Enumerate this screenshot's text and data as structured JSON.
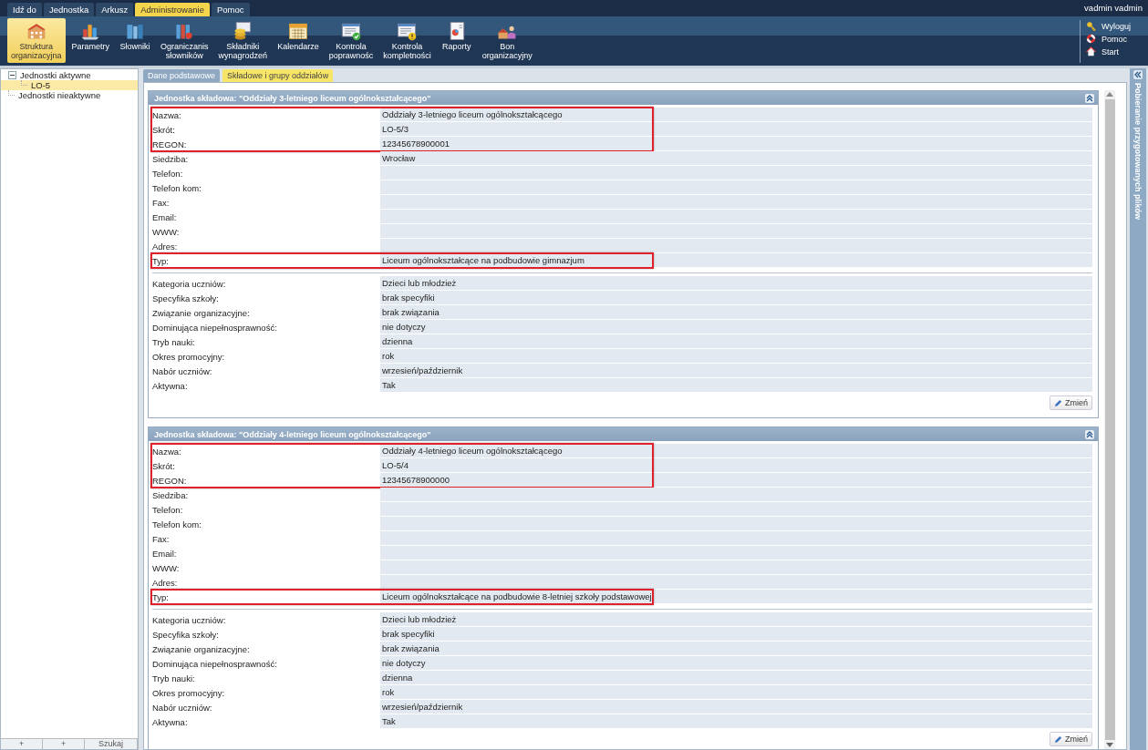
{
  "menu_bar": {
    "items": [
      {
        "label": "Idź do",
        "selected": false
      },
      {
        "label": "Jednostka",
        "selected": false
      },
      {
        "label": "Arkusz",
        "selected": false
      },
      {
        "label": "Administrowanie",
        "selected": true
      },
      {
        "label": "Pomoc",
        "selected": false
      }
    ],
    "user": "vadmin vadmin"
  },
  "toolbar": {
    "buttons": [
      {
        "label": "Struktura\norganizacyjna",
        "selected": true
      },
      {
        "label": "Parametry",
        "selected": false
      },
      {
        "label": "Słowniki",
        "selected": false
      },
      {
        "label": "Ograniczanis\nsłowników",
        "selected": false
      },
      {
        "label": "Składniki\nwynagrodzeń",
        "selected": false
      },
      {
        "label": "Kalendarze",
        "selected": false
      },
      {
        "label": "Kontrola\npoprawnośc",
        "selected": false
      },
      {
        "label": "Kontrola\nkompletności",
        "selected": false
      },
      {
        "label": "Raporty",
        "selected": false
      },
      {
        "label": "Bon\norganizacyjny",
        "selected": false
      }
    ],
    "links": [
      "Wyloguj",
      "Pomoc",
      "Start"
    ]
  },
  "sidebar": {
    "tree": [
      {
        "label": "Jednostki aktywne",
        "selected": false,
        "expanded": true,
        "children": [
          {
            "label": "LO-5",
            "selected": true
          }
        ]
      },
      {
        "label": "Jednostki nieaktywne",
        "selected": false
      }
    ],
    "buttons": [
      "+",
      "+",
      "Szukaj"
    ]
  },
  "tabs": [
    {
      "label": "Dane podstawowe",
      "selected": false
    },
    {
      "label": "Składowe i grupy oddziałów",
      "selected": true
    }
  ],
  "sections": [
    {
      "title": "Jednostka składowa: \"Oddziały 3-letniego liceum ogólnokształcącego\"",
      "groups": [
        {
          "highlighted": true,
          "fields": [
            {
              "label": "Nazwa:",
              "value": "Oddziały 3-letniego liceum ogólnokształcącego"
            },
            {
              "label": "Skrót:",
              "value": "LO-5/3"
            },
            {
              "label": "REGON:",
              "value": "12345678900001"
            }
          ]
        },
        {
          "highlighted": false,
          "fields": [
            {
              "label": "Siedziba:",
              "value": "Wrocław"
            },
            {
              "label": "Telefon:"
            },
            {
              "label": "Telefon kom:"
            },
            {
              "label": "Fax:"
            },
            {
              "label": "Email:"
            },
            {
              "label": "WWW:"
            },
            {
              "label": "Adres:"
            }
          ]
        },
        {
          "highlighted": true,
          "fields": [
            {
              "label": "Typ:",
              "value": "Liceum ogólnokształcące na podbudowie gimnazjum"
            }
          ]
        }
      ],
      "details": [
        {
          "label": "Kategoria uczniów:",
          "value": "Dzieci lub młodzież"
        },
        {
          "label": "Specyfika szkoły:",
          "value": "brak specyfiki"
        },
        {
          "label": "Związanie organizacyjne:",
          "value": "brak związania"
        },
        {
          "label": "Dominująca niepełnosprawność:",
          "value": "nie dotyczy"
        },
        {
          "label": "Tryb nauki:",
          "value": "dzienna"
        },
        {
          "label": "Okres promocyjny:",
          "value": "rok"
        },
        {
          "label": "Nabór uczniów:",
          "value": "wrzesień/październik"
        },
        {
          "label": "Aktywna:",
          "value": "Tak"
        }
      ],
      "button": "Zmień"
    },
    {
      "title": "Jednostka składowa: \"Oddziały 4-letniego liceum ogólnokształcącego\"",
      "groups": [
        {
          "highlighted": true,
          "fields": [
            {
              "label": "Nazwa:",
              "value": "Oddziały 4-letniego liceum ogólnokształcącego"
            },
            {
              "label": "Skrót:",
              "value": "LO-5/4"
            },
            {
              "label": "REGON:",
              "value": "12345678900000"
            }
          ]
        },
        {
          "highlighted": false,
          "fields": [
            {
              "label": "Siedziba:"
            },
            {
              "label": "Telefon:"
            },
            {
              "label": "Telefon kom:"
            },
            {
              "label": "Fax:"
            },
            {
              "label": "Email:"
            },
            {
              "label": "WWW:"
            },
            {
              "label": "Adres:"
            }
          ]
        },
        {
          "highlighted": true,
          "fields": [
            {
              "label": "Typ:",
              "value": "Liceum ogólnokształcące na podbudowie 8-letniej szkoły podstawowej"
            }
          ]
        }
      ],
      "details": [
        {
          "label": "Kategoria uczniów:",
          "value": "Dzieci lub młodzież"
        },
        {
          "label": "Specyfika szkoły:",
          "value": "brak specyfiki"
        },
        {
          "label": "Związanie organizacyjne:",
          "value": "brak związania"
        },
        {
          "label": "Dominująca niepełnosprawność:",
          "value": "nie dotyczy"
        },
        {
          "label": "Tryb nauki:",
          "value": "dzienna"
        },
        {
          "label": "Okres promocyjny:",
          "value": "rok"
        },
        {
          "label": "Nabór uczniów:",
          "value": "wrzesień/październik"
        },
        {
          "label": "Aktywna:",
          "value": "Tak"
        }
      ],
      "button": "Zmień"
    }
  ],
  "side_panel": {
    "title": "Pobieranie przygotowanych plików"
  }
}
